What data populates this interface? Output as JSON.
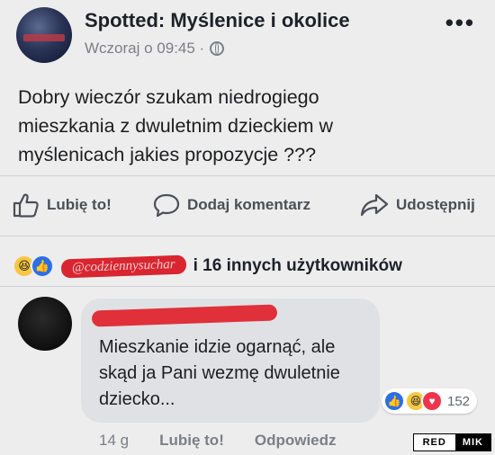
{
  "post": {
    "page_name": "Spotted: Myślenice i okolice",
    "timestamp": "Wczoraj o 09:45 ·",
    "more_label": "•••",
    "text": "Dobry wieczór szukam niedrogiego mieszkania z dwuletnim dzieckiem w myślenicach jakies propozycje ???",
    "actions": {
      "like": "Lubię to!",
      "comment": "Dodaj komentarz",
      "share": "Udostępnij"
    },
    "reactions": {
      "tagged_user": "@codziennysuchar",
      "others_text": "i 16 innych użytkowników"
    }
  },
  "comment": {
    "text": "Mieszkanie idzie ogarnąć, ale skąd ja Pani wezmę dwuletnie dziecko...",
    "reaction_count": "152",
    "age": "14 g",
    "like_label": "Lubię to!",
    "reply_label": "Odpowiedz"
  },
  "watermark": {
    "left": "RED",
    "right": "MIK"
  },
  "colors": {
    "accent": "#2b6fe6",
    "redaction": "#d9252f",
    "love": "#f0334d",
    "haha": "#f7c744"
  },
  "icons": [
    "globe-icon",
    "thumbs-up-icon",
    "comment-bubble-icon",
    "share-arrow-icon",
    "haha-reaction-icon",
    "like-reaction-icon",
    "love-reaction-icon"
  ]
}
